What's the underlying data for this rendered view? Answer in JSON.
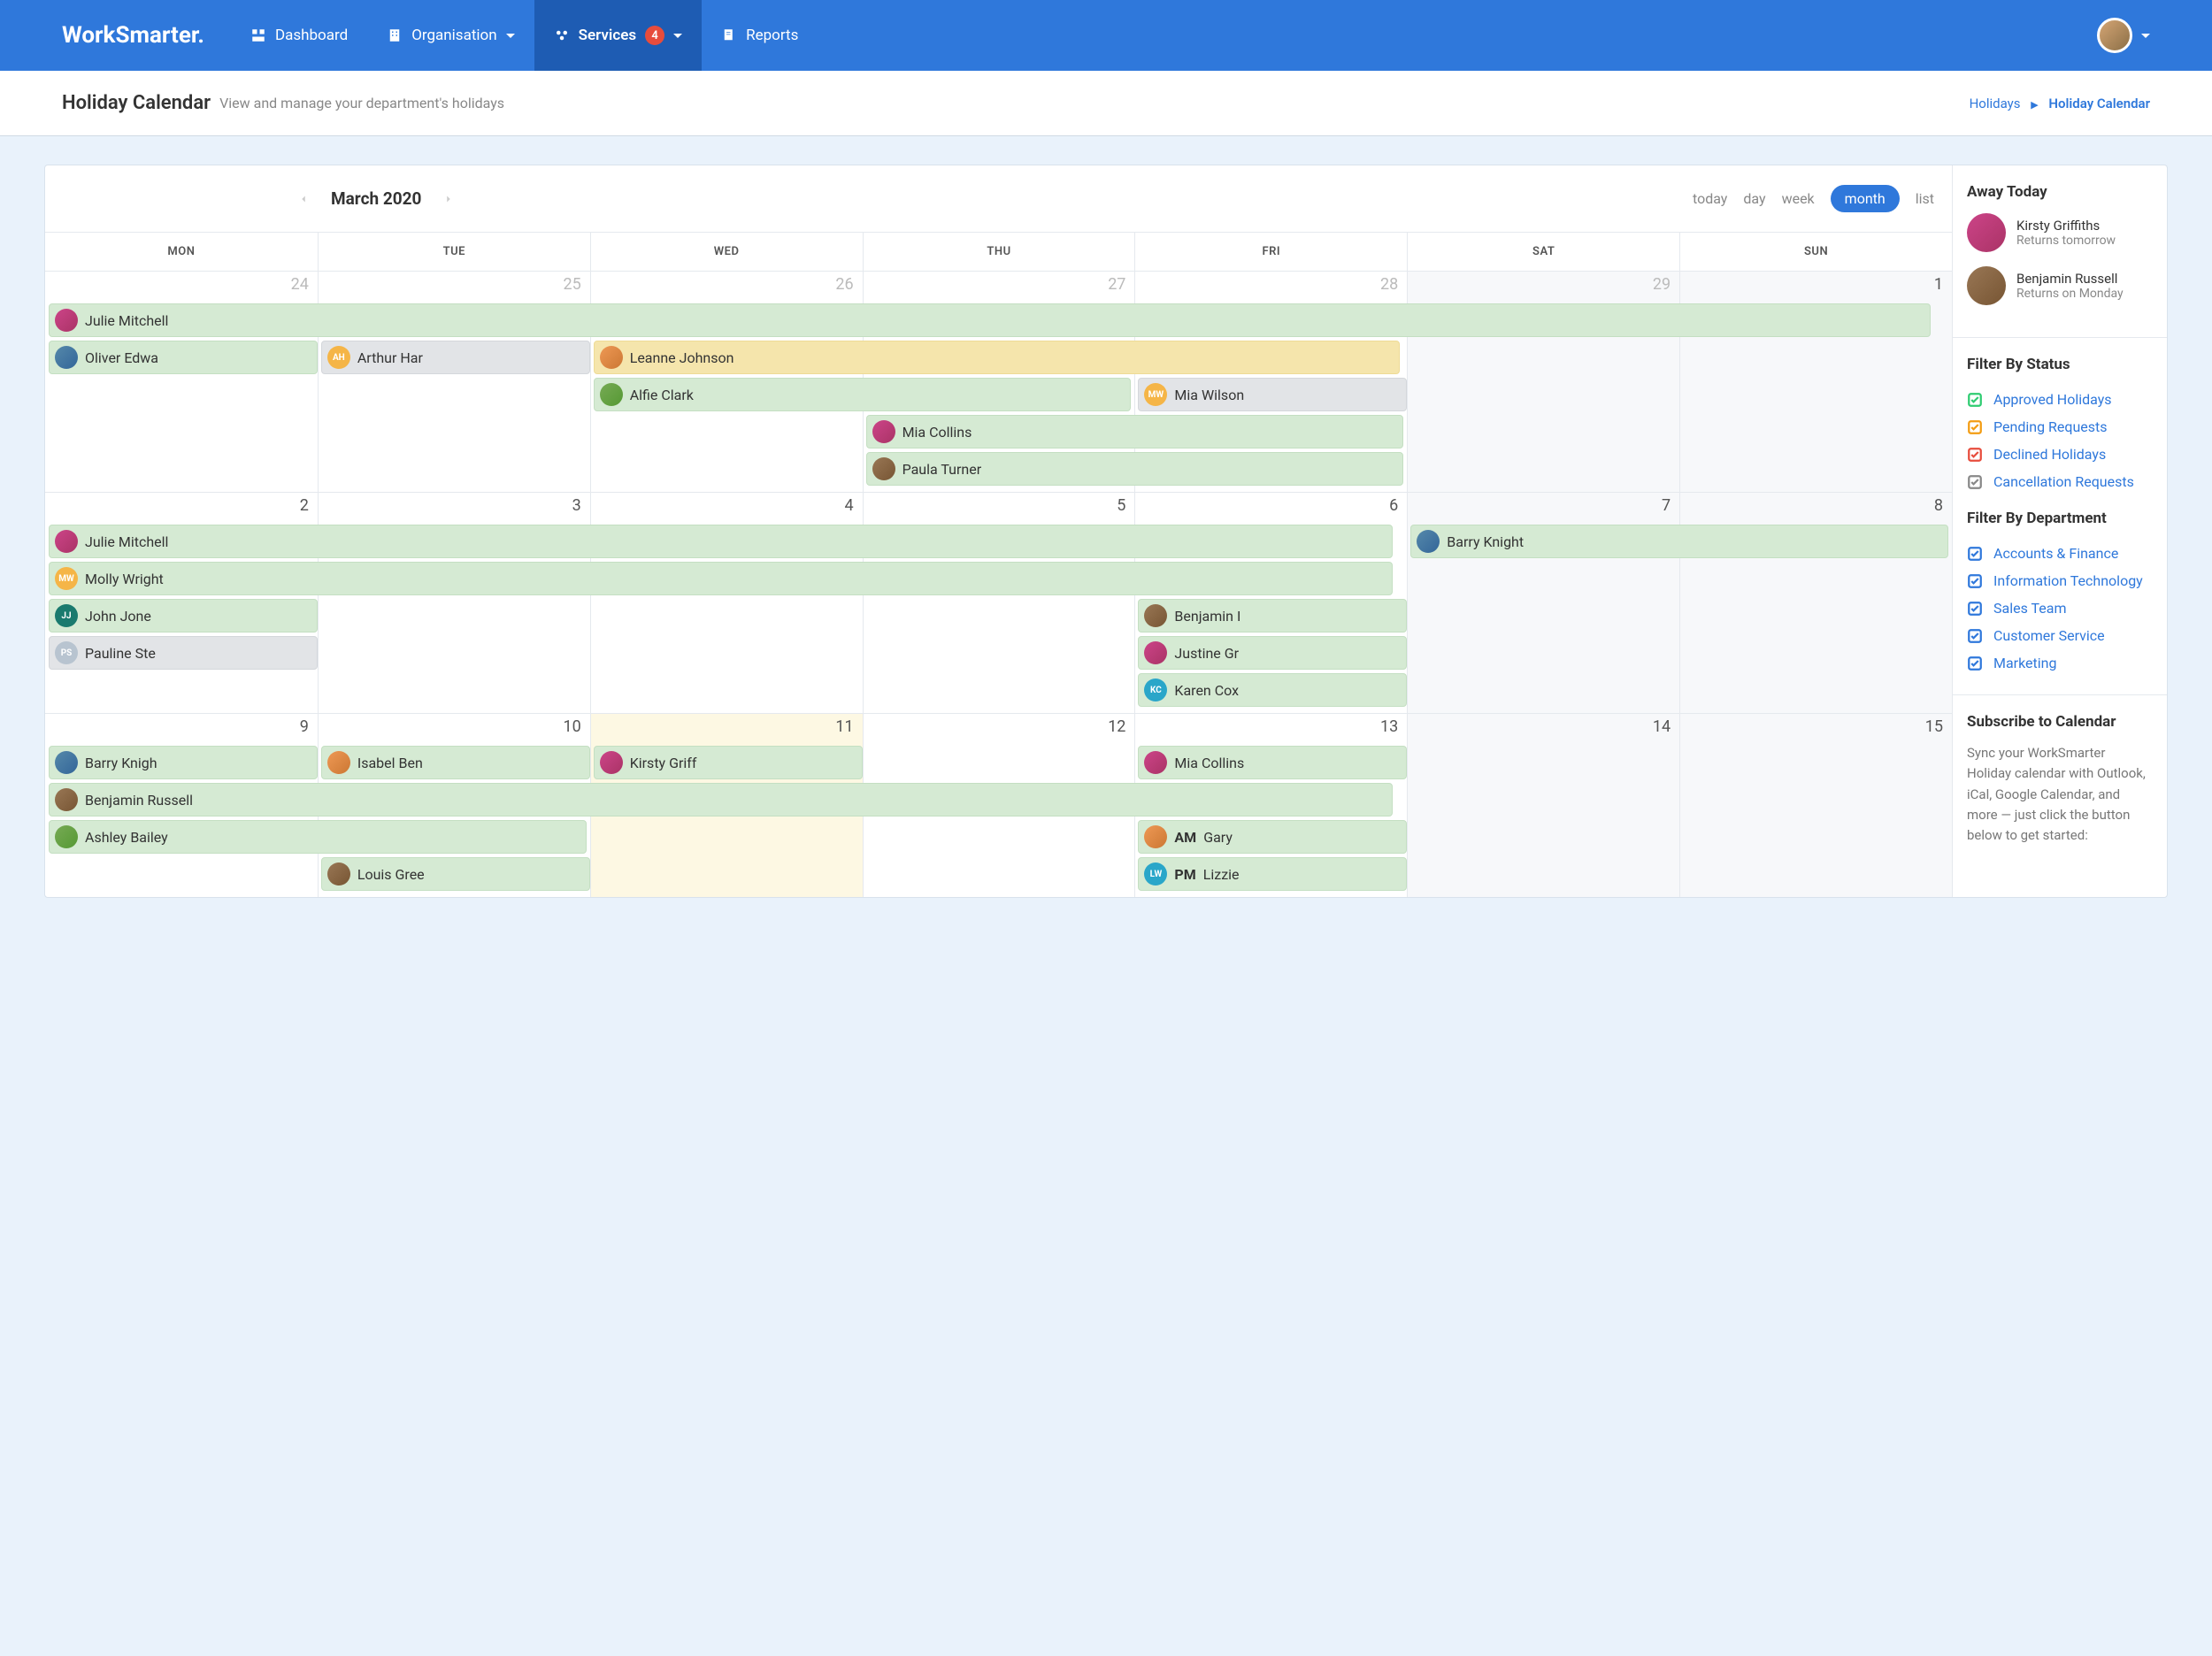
{
  "brand": "WorkSmarter.",
  "nav": {
    "dashboard": "Dashboard",
    "organisation": "Organisation",
    "services": "Services",
    "services_badge": "4",
    "reports": "Reports"
  },
  "page": {
    "title": "Holiday Calendar",
    "subtitle": "View and manage your department's holidays"
  },
  "breadcrumb": {
    "root": "Holidays",
    "current": "Holiday Calendar"
  },
  "calendar": {
    "month_label": "March 2020",
    "views": {
      "today": "today",
      "day": "day",
      "week": "week",
      "month": "month",
      "list": "list"
    },
    "dow": [
      "MON",
      "TUE",
      "WED",
      "THU",
      "FRI",
      "SAT",
      "SUN"
    ],
    "weeks": [
      {
        "dates": [
          {
            "n": "24",
            "muted": true
          },
          {
            "n": "25",
            "muted": true
          },
          {
            "n": "26",
            "muted": true
          },
          {
            "n": "27",
            "muted": true
          },
          {
            "n": "28",
            "muted": true
          },
          {
            "n": "29",
            "muted": true,
            "wknd": true
          },
          {
            "n": "1",
            "wknd": true
          }
        ],
        "events": [
          {
            "name": "Julie Mitchell",
            "color": "green",
            "start": 0,
            "span": 7,
            "av": "av1"
          },
          {
            "name": "Oliver Edwa",
            "color": "green",
            "start": 0,
            "span": 1,
            "av": "av2",
            "lane": 1
          },
          {
            "name": "Arthur Har",
            "color": "gray",
            "start": 1,
            "span": 1,
            "init": "AH",
            "avcls": "av-init",
            "lane": 1
          },
          {
            "name": "Leanne Johnson",
            "color": "yellow",
            "start": 2,
            "span": 3,
            "av": "av4",
            "lane": 1
          },
          {
            "name": "Alfie Clark",
            "color": "green",
            "start": 2,
            "span": 2,
            "av": "av3",
            "lane": 2
          },
          {
            "name": "Mia Wilson",
            "color": "gray",
            "start": 4,
            "span": 1,
            "init": "MW",
            "avcls": "av-init",
            "lane": 2
          },
          {
            "name": "Mia Collins",
            "color": "green",
            "start": 3,
            "span": 2,
            "av": "av1",
            "lane": 3
          },
          {
            "name": "Paula Turner",
            "color": "green",
            "start": 3,
            "span": 2,
            "av": "av5",
            "lane": 4
          }
        ]
      },
      {
        "dates": [
          {
            "n": "2"
          },
          {
            "n": "3"
          },
          {
            "n": "4"
          },
          {
            "n": "5"
          },
          {
            "n": "6"
          },
          {
            "n": "7",
            "wknd": true
          },
          {
            "n": "8",
            "wknd": true
          }
        ],
        "events": [
          {
            "name": "Julie Mitchell",
            "color": "green",
            "start": 0,
            "span": 5,
            "av": "av1"
          },
          {
            "name": "Barry Knight",
            "color": "green",
            "start": 5,
            "span": 2,
            "av": "av2"
          },
          {
            "name": "Molly Wright",
            "color": "green",
            "start": 0,
            "span": 5,
            "init": "MW",
            "avcls": "av-init",
            "lane": 1
          },
          {
            "name": "John Jone",
            "color": "green",
            "start": 0,
            "span": 1,
            "init": "JJ",
            "avcls": "av-teal",
            "lane": 2
          },
          {
            "name": "Benjamin I",
            "color": "green",
            "start": 4,
            "span": 1,
            "av": "av5",
            "lane": 2
          },
          {
            "name": "Pauline Ste",
            "color": "gray",
            "start": 0,
            "span": 1,
            "init": "PS",
            "avcls": "av-init3",
            "lane": 3
          },
          {
            "name": "Justine Gr",
            "color": "green",
            "start": 4,
            "span": 1,
            "av": "av1",
            "lane": 3
          },
          {
            "name": "Karen Cox",
            "color": "green",
            "start": 4,
            "span": 1,
            "init": "KC",
            "avcls": "av-init2",
            "lane": 4
          }
        ]
      },
      {
        "dates": [
          {
            "n": "9"
          },
          {
            "n": "10"
          },
          {
            "n": "11",
            "hl": true
          },
          {
            "n": "12"
          },
          {
            "n": "13"
          },
          {
            "n": "14",
            "wknd": true
          },
          {
            "n": "15",
            "wknd": true
          }
        ],
        "events": [
          {
            "name": "Barry Knigh",
            "color": "green",
            "start": 0,
            "span": 1,
            "av": "av2"
          },
          {
            "name": "Isabel Ben",
            "color": "green",
            "start": 1,
            "span": 1,
            "av": "av4",
            "lane": 0
          },
          {
            "name": "Kirsty Griff",
            "color": "green",
            "start": 2,
            "span": 1,
            "av": "av1",
            "lane": 0
          },
          {
            "name": "Mia Collins",
            "color": "green",
            "start": 4,
            "span": 1,
            "av": "av1",
            "lane": 0
          },
          {
            "name": "Benjamin Russell",
            "color": "green",
            "start": 0,
            "span": 5,
            "av": "av5",
            "lane": 1
          },
          {
            "name": "Ashley Bailey",
            "color": "green",
            "start": 0,
            "span": 2,
            "av": "av3",
            "lane": 2
          },
          {
            "name": "Gary ",
            "prefix": "AM",
            "color": "green",
            "start": 4,
            "span": 1,
            "av": "av4",
            "lane": 2
          },
          {
            "name": "Louis Gree",
            "color": "green",
            "start": 1,
            "span": 1,
            "av": "av5",
            "lane": 3
          },
          {
            "name": "Lizzie",
            "prefix": "PM",
            "color": "green",
            "start": 4,
            "span": 1,
            "init": "LW",
            "avcls": "av-init2",
            "lane": 3
          }
        ]
      }
    ]
  },
  "sidebar": {
    "away_title": "Away Today",
    "away": [
      {
        "name": "Kirsty Griffiths",
        "sub": "Returns tomorrow",
        "av": "av1"
      },
      {
        "name": "Benjamin Russell",
        "sub": "Returns on Monday",
        "av": "av5"
      }
    ],
    "filter_status_title": "Filter By Status",
    "status": [
      {
        "label": "Approved Holidays",
        "color": "#2ecc71"
      },
      {
        "label": "Pending Requests",
        "color": "#f39c12"
      },
      {
        "label": "Declined Holidays",
        "color": "#e74c3c"
      },
      {
        "label": "Cancellation Requests",
        "color": "#888"
      }
    ],
    "filter_dept_title": "Filter By Department",
    "departments": [
      "Accounts & Finance",
      "Information Technology",
      "Sales Team",
      "Customer Service",
      "Marketing"
    ],
    "subscribe_title": "Subscribe to Calendar",
    "subscribe_desc": "Sync your WorkSmarter Holiday calendar with Outlook, iCal, Google Calendar, and more — just click the button below to get started:"
  }
}
